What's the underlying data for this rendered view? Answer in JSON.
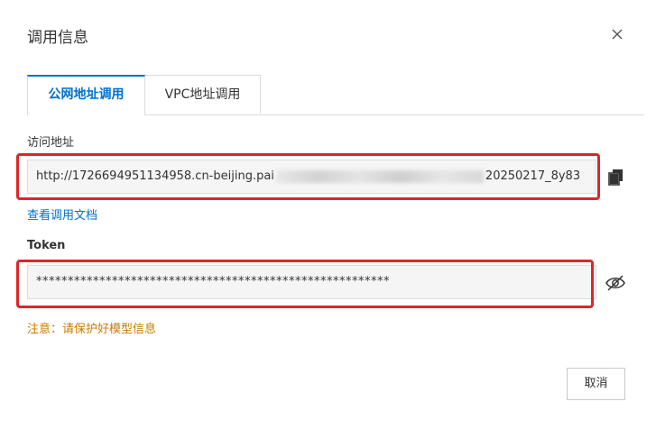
{
  "dialog": {
    "title": "调用信息",
    "close_icon": "close-icon"
  },
  "tabs": [
    {
      "label": "公网地址调用",
      "active": true
    },
    {
      "label": "VPC地址调用",
      "active": false
    }
  ],
  "endpoint": {
    "label": "访问地址",
    "value_prefix": "http://1726694951134958.cn-beijing.pai",
    "value_suffix": "20250217_8y83",
    "copy_icon": "copy-icon",
    "doc_link": "查看调用文档"
  },
  "token": {
    "label": "Token",
    "value": "********************************************************",
    "toggle_icon": "eye-slash-icon"
  },
  "warning": "注意：请保护好模型信息",
  "footer": {
    "cancel_label": "取消"
  },
  "colors": {
    "accent": "#0070cc",
    "warning": "#c97a00",
    "highlight": "#e0242a"
  }
}
